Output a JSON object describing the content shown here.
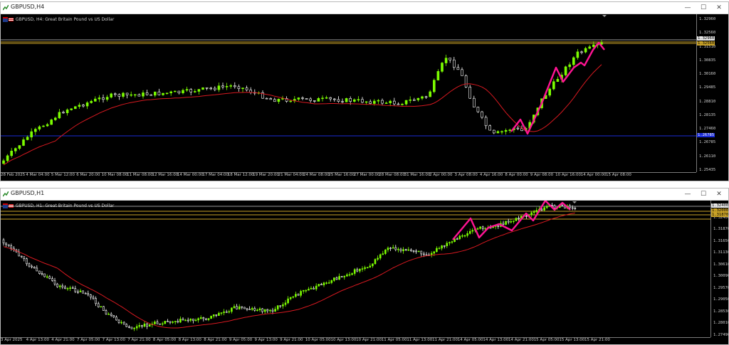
{
  "colors": {
    "bull": "#7CFC00",
    "bear": "#ffffff",
    "ma": "#d71920",
    "zigzag": "#ff1493",
    "gold": "#c9a227",
    "blue": "#1a2bd6",
    "bg": "#000000"
  },
  "symbol": "Great Britain Pound vs US Dollar",
  "top": {
    "title": "GBPUSD,H4",
    "legend": "GBPUSD, H4:  Great Britain Pound vs US Dollar",
    "price_labels": [
      "1.32960",
      "1.32560",
      "1.31510",
      "1.30835",
      "1.30160",
      "1.29485",
      "1.28810",
      "1.28135",
      "1.27460",
      "1.26785",
      "1.26110",
      "1.25435"
    ],
    "tags": [
      {
        "text": "1.32960",
        "kind": "bid"
      },
      {
        "text": "1.32560",
        "kind": "gold"
      },
      {
        "text": "1.26785",
        "kind": "blue"
      }
    ],
    "time_labels": [
      "28 Feb 2025",
      "4 Mar 04:00",
      "5 Mar 12:00",
      "6 Mar 20:00",
      "10 Mar 08:00",
      "11 Mar 08:00",
      "12 Mar 16:00",
      "14 Mar 00:00",
      "17 Mar 04:00",
      "18 Mar 12:00",
      "19 Mar 20:00",
      "21 Mar 04:00",
      "24 Mar 08:00",
      "25 Mar 16:00",
      "27 Mar 00:00",
      "28 Mar 08:00",
      "31 Mar 16:00",
      "2 Apr 00:00",
      "3 Apr 08:00",
      "4 Apr 16:00",
      "8 Apr 00:00",
      "9 Apr 08:00",
      "10 Apr 16:00",
      "14 Apr 00:00",
      "15 Apr 08:00"
    ]
  },
  "bottom": {
    "title": "GBPUSD,H1",
    "legend": "GBPUSD, H1:  Great Britain Pound vs US Dollar",
    "price_labels": [
      "1.32930",
      "1.32400",
      "1.31870",
      "1.31650",
      "1.31130",
      "1.30610",
      "1.30090",
      "1.29570",
      "1.29050",
      "1.28530",
      "1.28010",
      "1.27490"
    ],
    "tags": [
      {
        "text": "1.32400",
        "kind": "bid"
      },
      {
        "text": "1.32000",
        "kind": "gold"
      },
      {
        "text": "1.31870",
        "kind": "gold"
      }
    ],
    "time_labels": [
      "3 Apr 2025",
      "4 Apr 13:00",
      "4 Apr 21:00",
      "7 Apr 05:00",
      "7 Apr 13:00",
      "7 Apr 21:00",
      "8 Apr 05:00",
      "8 Apr 13:00",
      "8 Apr 21:00",
      "9 Apr 05:00",
      "9 Apr 13:00",
      "9 Apr 21:00",
      "10 Apr 05:00",
      "10 Apr 13:00",
      "10 Apr 21:00",
      "11 Apr 05:00",
      "11 Apr 13:00",
      "11 Apr 21:00",
      "14 Apr 05:00",
      "14 Apr 13:00",
      "14 Apr 21:00",
      "15 Apr 05:00",
      "15 Apr 13:00",
      "15 Apr 21:00"
    ]
  },
  "window_buttons": {
    "minimize": "—",
    "maximize": "☐",
    "close": "✕"
  }
}
